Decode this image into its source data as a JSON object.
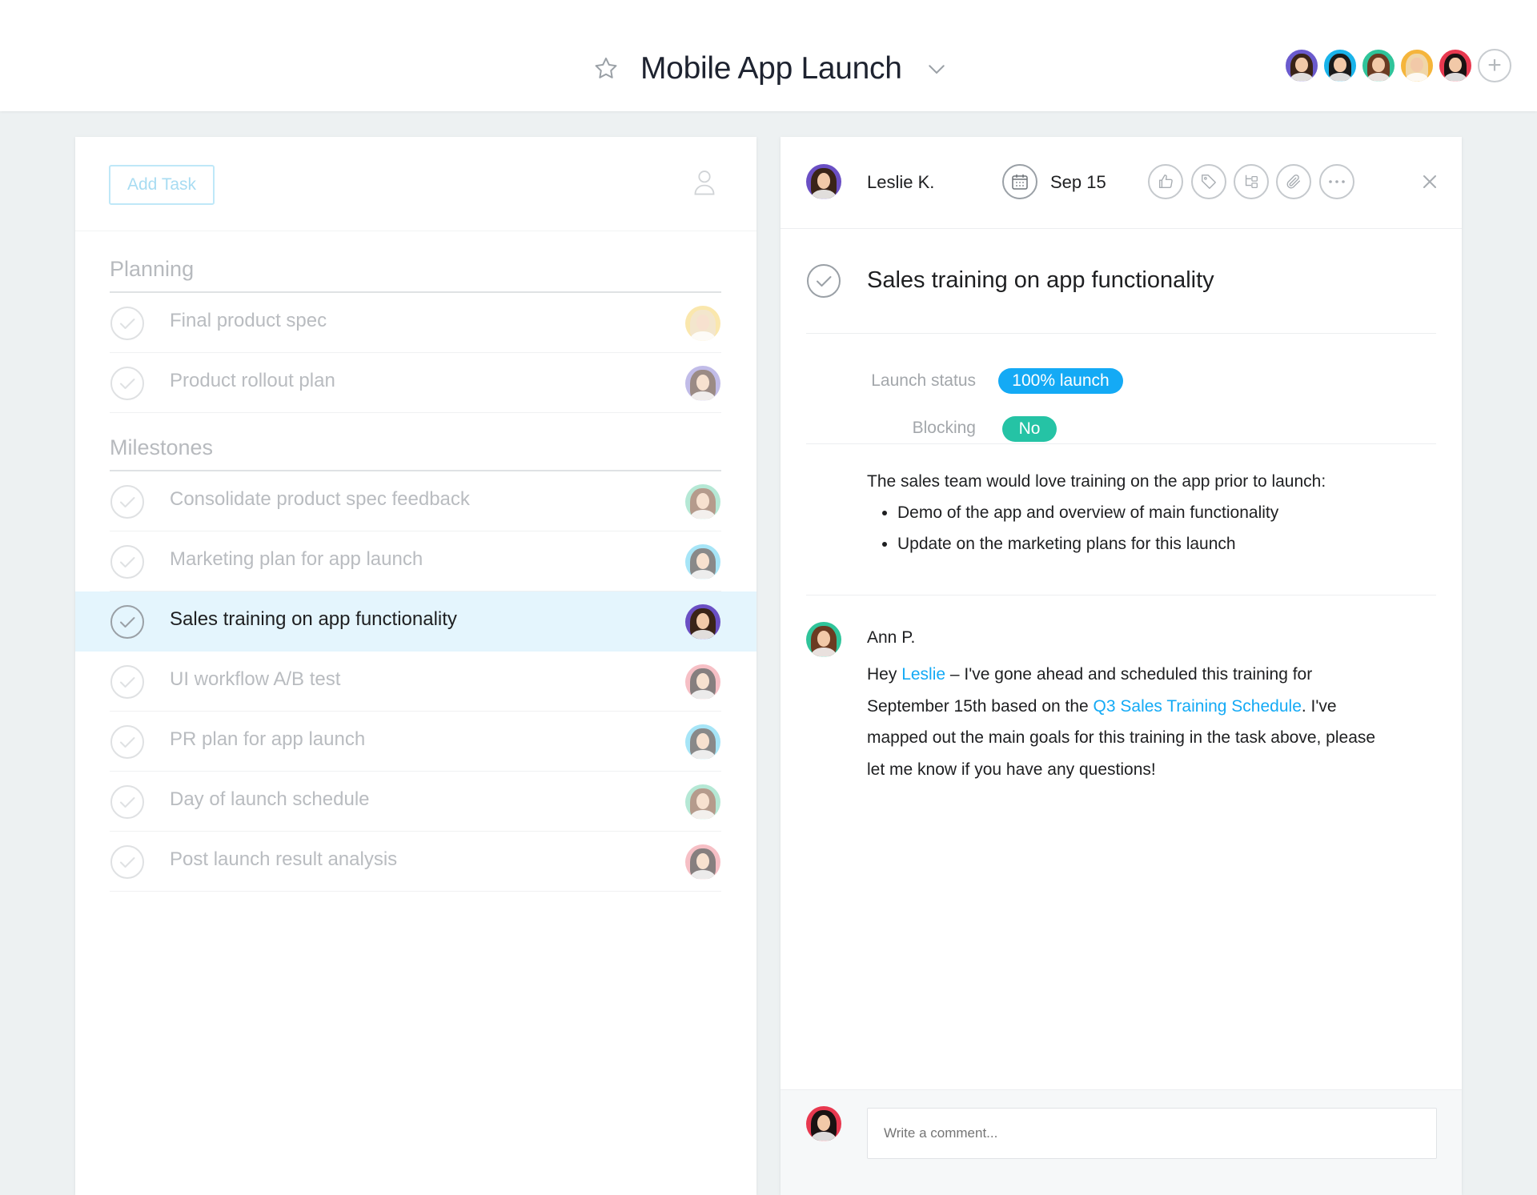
{
  "header": {
    "project_title": "Mobile App Launch",
    "add_member_label": "+",
    "members": [
      {
        "name": "member-1",
        "bg": "#6a5acd",
        "hair": "#3a2418"
      },
      {
        "name": "member-2",
        "bg": "#19b3ea",
        "hair": "#1a1a1a"
      },
      {
        "name": "member-3",
        "bg": "#2fc49a",
        "hair": "#6b3b22"
      },
      {
        "name": "member-4",
        "bg": "#f5b53b",
        "hair": "#f0d6a8"
      },
      {
        "name": "member-5",
        "bg": "#e8384f",
        "hair": "#1a1212"
      }
    ]
  },
  "task_list": {
    "add_task_label": "Add Task",
    "sections": [
      {
        "title": "Planning",
        "tasks": [
          {
            "name": "Final product spec",
            "avatar_bg": "#f7d46b",
            "hair": "#ead2a5"
          },
          {
            "name": "Product rollout plan",
            "avatar_bg": "#8f86d6",
            "hair": "#4a2e22"
          }
        ]
      },
      {
        "title": "Milestones",
        "tasks": [
          {
            "name": "Consolidate product spec feedback",
            "avatar_bg": "#7ad6b4",
            "hair": "#7a4a30"
          },
          {
            "name": "Marketing plan for app launch",
            "avatar_bg": "#5fd0f2",
            "hair": "#2a2a2a"
          },
          {
            "name": "Sales training on app functionality",
            "avatar_bg": "#6a4fc4",
            "hair": "#3a2418",
            "selected": true
          },
          {
            "name": "UI workflow A/B test",
            "avatar_bg": "#f08c96",
            "hair": "#241818"
          },
          {
            "name": "PR plan for app launch",
            "avatar_bg": "#5fd0f2",
            "hair": "#2a2a2a"
          },
          {
            "name": "Day of launch schedule",
            "avatar_bg": "#7ad6b4",
            "hair": "#7a4a30"
          },
          {
            "name": "Post launch result analysis",
            "avatar_bg": "#f08c96",
            "hair": "#241818"
          }
        ]
      }
    ]
  },
  "detail": {
    "assignee": "Leslie K.",
    "due_date": "Sep 15",
    "title": "Sales training on app functionality",
    "fields": [
      {
        "label": "Launch status",
        "value": "100% launch",
        "color": "#14aaf5"
      },
      {
        "label": "Blocking",
        "value": "No",
        "color": "#25c3a5"
      }
    ],
    "description": {
      "intro": "The sales team would love training on the app prior to launch:",
      "bullets": [
        "Demo of the app and overview of main functionality",
        "Update on the marketing plans for this launch"
      ]
    },
    "comment": {
      "author": "Ann P.",
      "part1": "Hey ",
      "mention": "Leslie",
      "part2": " – I've gone ahead and scheduled this training for September 15th based on the ",
      "link": "Q3 Sales Training Schedule",
      "part3": ". I've mapped out the main goals for this training in the task above, please let me know if you have any questions!"
    },
    "composer_placeholder": "Write a comment..."
  },
  "colors": {
    "accent": "#14aaf5",
    "selected_row": "#e4f5fd",
    "teal": "#25c3a5"
  }
}
